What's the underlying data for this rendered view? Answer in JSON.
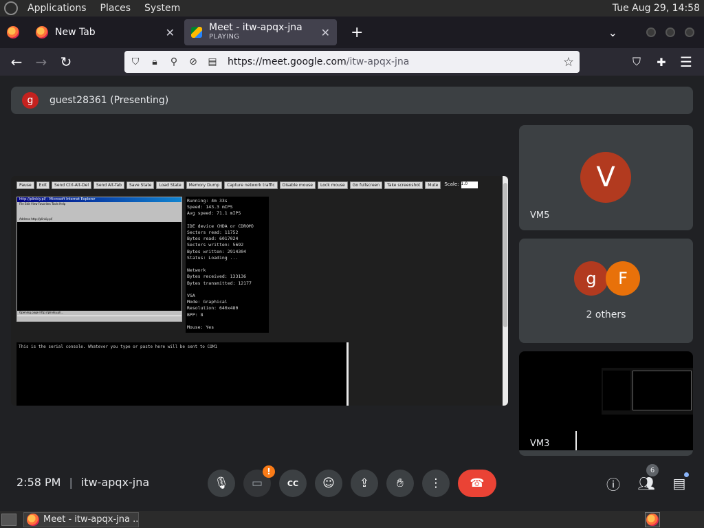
{
  "top_panel": {
    "menus": [
      "Applications",
      "Places",
      "System"
    ],
    "clock": "Tue Aug 29, 14:58"
  },
  "browser": {
    "tabs": [
      {
        "title": "New Tab",
        "subtitle": "",
        "active": false
      },
      {
        "title": "Meet - itw-apqx-jna",
        "subtitle": "PLAYING",
        "active": true
      }
    ],
    "url_prefix": "https://meet.google.com",
    "url_path": "/itw-apqx-jna"
  },
  "meet": {
    "presenter_initial": "g",
    "presenter_label": "guest28361 (Presenting)",
    "vm": {
      "toolbar_buttons": [
        "Pause",
        "Exit",
        "Send Ctrl-Alt-Del",
        "Send Alt-Tab",
        "Save State",
        "Load State",
        "Memory Dump",
        "Capture network traffic",
        "Disable mouse",
        "Lock mouse",
        "Go fullscreen",
        "Take screenshot",
        "Mute"
      ],
      "scale_label": "Scale:",
      "scale_value": "1.0",
      "window_title": "http://plinkiy.pl/ - Microsoft Internet Explorer",
      "menu_text": "File  Edit  View  Favorites  Tools  Help",
      "address_text": "Address  http://plinkiy.pl/",
      "status_text": "Opening page http://plinkiy.pl/...",
      "stats_text": "Running: 4m 33s\nSpeed: 143.3 mIPS\nAvg speed: 71.1 mIPS\n\nIDE device (HDA or CDROM)\nSectors read: 11752\nBytes read: 6017024\nSectors written: 5692\nBytes written: 2914304\nStatus: Loading ...\n\nNetwork\nBytes received: 133136\nBytes transmitted: 12177\n\nVGA\nMode: Graphical\nResolution: 640x480\nBPP: 8\n\nMouse: Yes",
      "serial_text": "This is the serial console. Whatever you type or paste here will be sent to COM1"
    },
    "tiles": {
      "vm5": {
        "initial": "V",
        "name": "VM5",
        "color": "#b23a1f"
      },
      "others": {
        "initials": [
          "g",
          "F"
        ],
        "colors": [
          "#b23a1f",
          "#e8710a"
        ],
        "label": "2 others"
      },
      "vm3": {
        "name": "VM3"
      }
    },
    "controls": {
      "time": "2:58 PM",
      "meeting_code": "itw-apqx-jna",
      "camera_warning": "!",
      "participants_count": "6",
      "end_call_color": "#ea4335"
    }
  },
  "bottom_panel": {
    "task_label": "Meet - itw-apqx-jna ..."
  }
}
